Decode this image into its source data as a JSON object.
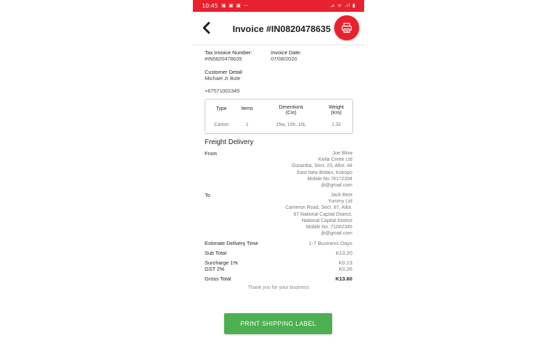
{
  "status_bar": {
    "time": "10:45",
    "notification_icons": "▣ ▣ ▣  ⋯",
    "system_icons": "⊿ ᯤ .ıl ▮"
  },
  "header": {
    "title": "Invoice #IN0820478635"
  },
  "invoice": {
    "tax_invoice_label": "Tax Invoice Number:",
    "tax_invoice_value": "#IN0820478635",
    "date_label": "Invoice Date:",
    "date_value": "07/08/2020",
    "customer_label": "Customer Detail",
    "customer_name": "Michael Jr Bole",
    "customer_phone": "+67571002345"
  },
  "items_table": {
    "headers": {
      "type": "Type",
      "items": "Items",
      "dimensions_1": "Dimentions",
      "dimensions_2": "(Cm)",
      "weight_1": "Weight",
      "weight_2": "(Km)"
    },
    "row": {
      "type": "Carton",
      "items": "1",
      "dimensions": "15w, 10h, 10L",
      "weight": "1.32"
    }
  },
  "freight": {
    "title": "Freight Delivery",
    "from_label": "From",
    "from_lines": [
      "Joe Blow",
      "Kwila Creek Ltd",
      "Gunanba, Sect. 23, Allot. 44",
      "East New Britain, Kokopo",
      "Mobile No.76172204",
      "jb@gmail.com"
    ],
    "to_label": "To",
    "to_lines": [
      "Jack Beet",
      "Yummy Ltd",
      "Cameron Road, Sect. 87, Allot.",
      "67 National Capital District,",
      "National Capital District",
      "Mobile No. 71002345",
      "jb@gmail.com"
    ]
  },
  "summary": {
    "delivery_label": "Estimate Delivery Time",
    "delivery_value": "1-7 Business Days",
    "subtotal_label": "Sub Total",
    "subtotal_value": "K13.20",
    "surcharge_label": "Surcharge 1%",
    "surcharge_value": "K0.13",
    "gst_label": "GST 2%",
    "gst_value": "K0.26",
    "gross_label": "Gross Total",
    "gross_value": "K13.60"
  },
  "footer": {
    "thanks": "Thank you for your business",
    "print_button": "PRINT SHIPPING LABEL"
  },
  "colors": {
    "accent_red": "#e8212f",
    "button_green": "#4caf50"
  }
}
